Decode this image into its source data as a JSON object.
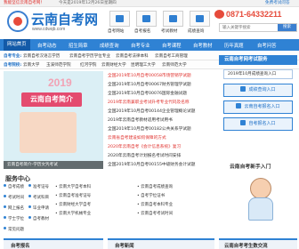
{
  "topbar": {
    "left_text": "我能坚信云南自考网！",
    "center_text": "今天是2019年12月26日星期四",
    "right_text": "免费考试问答"
  },
  "logo": {
    "title": "云南自考网",
    "url": "www.cdwqb.com"
  },
  "quick_links": [
    {
      "label": "自考网站",
      "icon": "monitor-icon"
    },
    {
      "label": "自考报名",
      "icon": "form-icon"
    },
    {
      "label": "考试教材",
      "icon": "book-icon"
    },
    {
      "label": "成绩查询",
      "icon": "search-icon"
    }
  ],
  "contact": {
    "phone": "0871-64332211",
    "icon": "phone-icon"
  },
  "search": {
    "placeholder": "输入关键字搜索",
    "button": "搜索"
  },
  "nav": {
    "items": [
      "网站首页",
      "自考动态",
      "招生简章",
      "成绩查询",
      "自考专业",
      "自考课程",
      "自考教材",
      "历年真题",
      "自考问答"
    ],
    "active_index": 0
  },
  "link_rows": [
    {
      "label": "自考专业:",
      "links": [
        "云南自考汉语言学历",
        "云南自考学历学位专业",
        "云南自考法律本科",
        "云南自考工商管理",
        "云南自考行政管理"
      ]
    },
    {
      "label": "自考院校:",
      "links": [
        "云南大学",
        "玉溪师范学院",
        "红河学院",
        "云南财经大学",
        "昆明理工大学",
        "云南师范大学"
      ]
    }
  ],
  "banner": {
    "year": "2019",
    "title": "云南自考简介",
    "caption": "云南自考简介-学历文凭考试"
  },
  "news": [
    {
      "text": "全国2019年10月自考00058市场营销学试题",
      "highlight": true
    },
    {
      "text": "全国2019年10月自考00067财务管理学试题",
      "highlight": false
    },
    {
      "text": "全国2019年10月自考00076国际金融试题",
      "highlight": false
    },
    {
      "text": "2019年云南兼职业考试升考专业代码及名称",
      "highlight": true
    },
    {
      "text": "全国2019年10月自考00144企业管理概论试题",
      "highlight": false
    },
    {
      "text": "2019年云南自考教材适用考试用书",
      "highlight": false
    },
    {
      "text": "全国2019年10月自考00182公共关系学试题",
      "highlight": false
    },
    {
      "text": "云南省自考建设如何保障的方式",
      "highlight": true
    },
    {
      "text": "2020年云南自考《会计信息系统》复习",
      "highlight": true
    },
    {
      "text": "2020年云南自考计划报名考试时间安排",
      "highlight": false
    },
    {
      "text": "全国2019年10月自考00155中级财务会计试题",
      "highlight": false
    }
  ],
  "sidebar": {
    "header": "云南自考网考试服务",
    "select_value": "2019年10月成绩查询入口",
    "buttons": [
      "成绩查询入口",
      "云南自考报名入口",
      "自考报名入口"
    ]
  },
  "service": {
    "title": "服务中心",
    "grid": [
      "自考成绩",
      "准考证号",
      "考试时间",
      "考试科目",
      "网上报名",
      "毕业申请",
      "学士学位",
      "自考教材",
      "常见问题"
    ],
    "list": [
      "• 云南大学自考本科",
      "• 云南自考准考证号",
      "• 云南财经大学自考",
      "• 云南大学机械专业",
      "• 云南自考成绩查询",
      "• 自考学位证书",
      "• 云南自考本科专业",
      "• 云南自考考试时间"
    ]
  },
  "bottom_tabs": [
    "自考报名",
    "自考新闻",
    "云南自考考生数交流"
  ],
  "mascot_title": "云南自考新手入门"
}
